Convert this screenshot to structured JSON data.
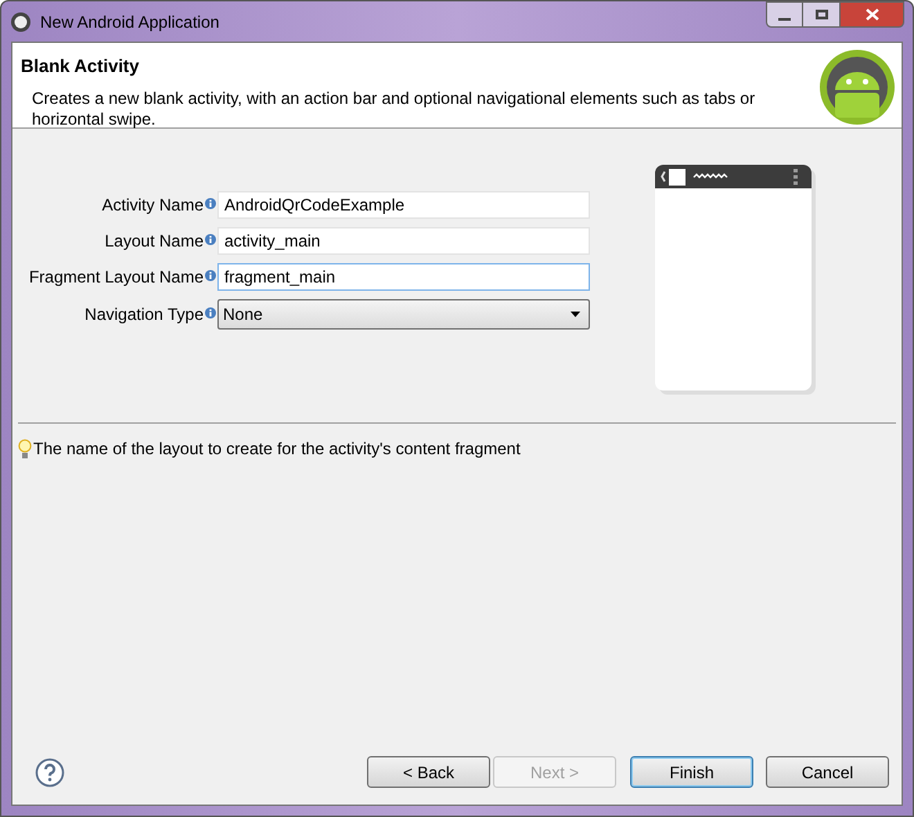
{
  "window": {
    "title": "New Android Application"
  },
  "header": {
    "title": "Blank Activity",
    "description": "Creates a new blank activity, with an action bar and optional navigational elements such as tabs or horizontal swipe."
  },
  "fields": [
    {
      "kind": "text",
      "label": "Activity Name",
      "value": "AndroidQrCodeExample",
      "focused": false
    },
    {
      "kind": "text",
      "label": "Layout Name",
      "value": "activity_main",
      "focused": false
    },
    {
      "kind": "text",
      "label": "Fragment Layout Name",
      "value": "fragment_main",
      "focused": true
    },
    {
      "kind": "dropdown",
      "label": "Navigation Type",
      "value": "None",
      "focused": false
    }
  ],
  "hint": "The name of the layout to create for the activity's content fragment",
  "buttons": [
    {
      "label": "< Back",
      "disabled": false,
      "default": false
    },
    {
      "label": "Next >",
      "disabled": true,
      "default": false
    },
    {
      "label": "Finish",
      "disabled": false,
      "default": true
    },
    {
      "label": "Cancel",
      "disabled": false,
      "default": false
    }
  ]
}
